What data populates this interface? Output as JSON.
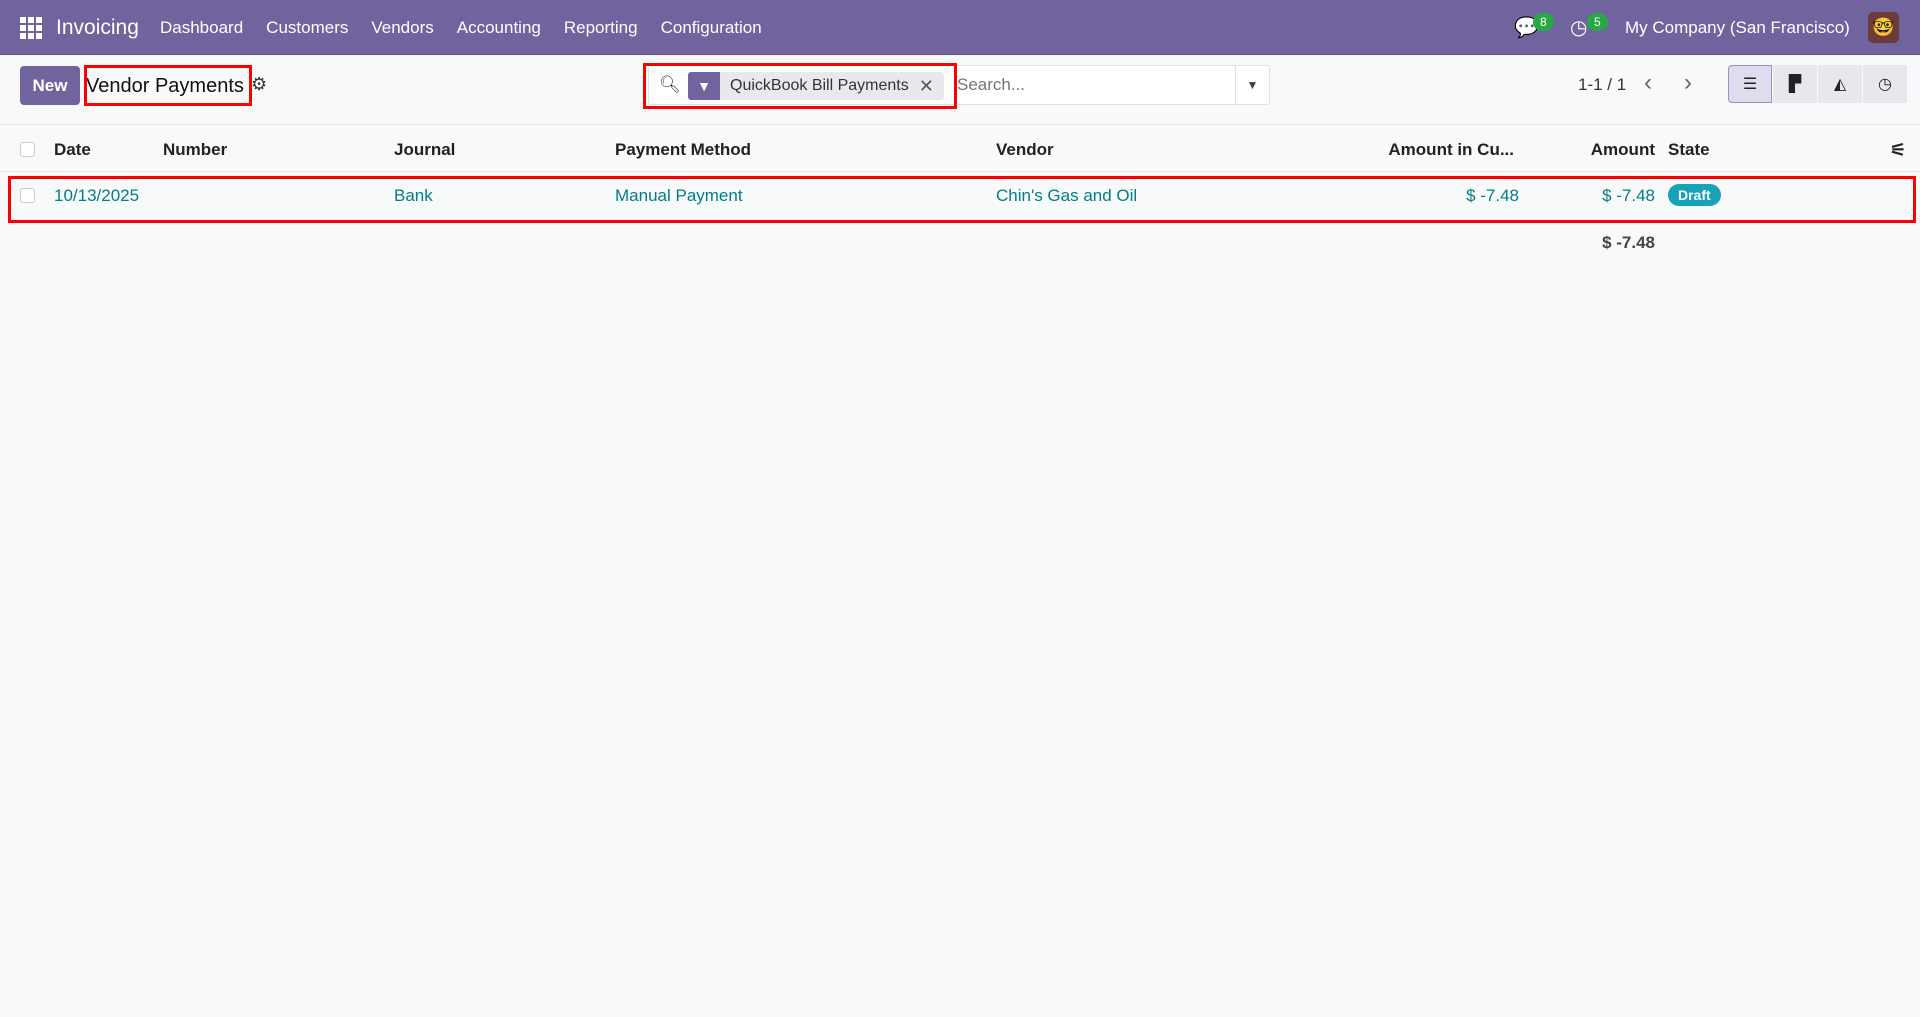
{
  "navbar": {
    "app_name": "Invoicing",
    "menu": [
      "Dashboard",
      "Customers",
      "Vendors",
      "Accounting",
      "Reporting",
      "Configuration"
    ],
    "messages_count": "8",
    "activities_count": "5",
    "company": "My Company (San Francisco)"
  },
  "control_panel": {
    "new_label": "New",
    "title": "Vendor Payments",
    "facet_label": "QuickBook Bill Payments",
    "search_placeholder": "Search...",
    "pager": "1-1 / 1"
  },
  "views": [
    "list",
    "kanban",
    "graph",
    "activity"
  ],
  "table": {
    "headers": [
      "Date",
      "Number",
      "Journal",
      "Payment Method",
      "Vendor",
      "Amount in Cu...",
      "Amount",
      "State"
    ],
    "rows": [
      {
        "date": "10/13/2025",
        "number": "",
        "journal": "Bank",
        "payment_method": "Manual Payment",
        "vendor": "Chin's Gas and Oil",
        "amount_currency": "$ -7.48",
        "amount": "$ -7.48",
        "state": "Draft"
      }
    ],
    "total": "$ -7.48"
  },
  "colors": {
    "brand": "#71639e",
    "link": "#017e84",
    "draft_badge": "#17a2b8",
    "highlight": "#ff0000"
  }
}
